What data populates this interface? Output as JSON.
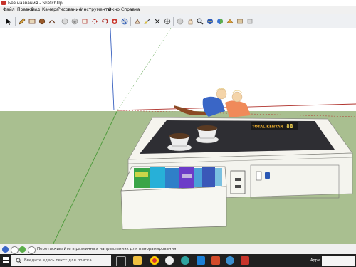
{
  "window": {
    "title": "Без названия - SketchUp",
    "accent": "#c7342b"
  },
  "menu": [
    "Файл",
    "Правка",
    "Вид",
    "Камера",
    "Рисование",
    "Инструменты",
    "Окно",
    "Справка"
  ],
  "toolbar": {
    "tools": [
      "select-icon",
      "pencil-icon",
      "rectangle-icon",
      "circle-icon",
      "arc-icon",
      "eraser-icon",
      "paint-bucket-icon",
      "push-pull-icon",
      "move-icon",
      "rotate-icon",
      "follow-me-icon",
      "scale-icon",
      "offset-icon",
      "tape-measure-icon",
      "text-icon",
      "axes-icon",
      "orbit-icon",
      "pan-icon",
      "zoom-icon",
      "zoom-extents-icon",
      "previous-view-icon",
      "section-plane-icon",
      "walk-icon",
      "warehouse-icon",
      "extension-icon"
    ]
  },
  "scene": {
    "display_label": "TOTAL KENYAN",
    "display_number": "88",
    "colors": {
      "sky": "#ffffff",
      "ground": "#a9bf90",
      "table_top": "#2e2e33",
      "table_side": "#f4f4ee",
      "axis_red": "#b0322c",
      "axis_green": "#4c9a3a",
      "axis_blue": "#3a62c0"
    }
  },
  "status": {
    "hint": "Перетаскивайте в различных направлениях для панорамирования"
  },
  "taskbar": {
    "search_placeholder": "Введите здесь текст для поиска",
    "tray_text": "Apple"
  }
}
